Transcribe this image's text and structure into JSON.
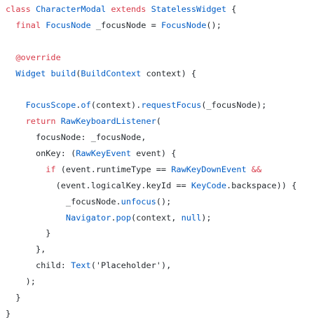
{
  "editor": {
    "lines": [
      [
        [
          "class ",
          "kw"
        ],
        [
          "CharacterModal ",
          "ty"
        ],
        [
          "extends ",
          "kw"
        ],
        [
          "StatelessWidget ",
          "ty"
        ],
        [
          "{",
          "pl"
        ]
      ],
      [
        [
          "  final ",
          "kw"
        ],
        [
          "FocusNode ",
          "ty"
        ],
        [
          "_focusNode = ",
          "pl"
        ],
        [
          "FocusNode",
          "ty"
        ],
        [
          "();",
          "pl"
        ]
      ],
      [],
      [
        [
          "  @override",
          "ann"
        ]
      ],
      [
        [
          "  Widget ",
          "ty"
        ],
        [
          "build",
          "ty"
        ],
        [
          "(",
          "pl"
        ],
        [
          "BuildContext ",
          "ty"
        ],
        [
          "context) {",
          "pl"
        ]
      ],
      [],
      [
        [
          "    FocusScope",
          "ty"
        ],
        [
          ".",
          "pl"
        ],
        [
          "of",
          "ty"
        ],
        [
          "(context).",
          "pl"
        ],
        [
          "requestFocus",
          "ty"
        ],
        [
          "(_focusNode);",
          "pl"
        ]
      ],
      [
        [
          "    return ",
          "kw"
        ],
        [
          "RawKeyboardListener",
          "ty"
        ],
        [
          "(",
          "pl"
        ]
      ],
      [
        [
          "      focusNode: _focusNode,",
          "pl"
        ]
      ],
      [
        [
          "      onKey: (",
          "pl"
        ],
        [
          "RawKeyEvent ",
          "ty"
        ],
        [
          "event) {",
          "pl"
        ]
      ],
      [
        [
          "        if ",
          "kw"
        ],
        [
          "(event.runtimeType == ",
          "pl"
        ],
        [
          "RawKeyDownEvent ",
          "ty"
        ],
        [
          "&&",
          "kw"
        ]
      ],
      [
        [
          "          (event.logicalKey.keyId == ",
          "pl"
        ],
        [
          "KeyCode",
          "ty"
        ],
        [
          ".backspace)) {",
          "pl"
        ]
      ],
      [
        [
          "            _focusNode.",
          "pl"
        ],
        [
          "unfocus",
          "ty"
        ],
        [
          "();",
          "pl"
        ]
      ],
      [
        [
          "            Navigator",
          "ty"
        ],
        [
          ".",
          "pl"
        ],
        [
          "pop",
          "ty"
        ],
        [
          "(context, ",
          "pl"
        ],
        [
          "null",
          "ty"
        ],
        [
          ");",
          "pl"
        ]
      ],
      [
        [
          "        }",
          "pl"
        ]
      ],
      [
        [
          "      },",
          "pl"
        ]
      ],
      [
        [
          "      child: ",
          "pl"
        ],
        [
          "Text",
          "ty"
        ],
        [
          "(",
          "pl"
        ],
        [
          "'Placeholder'",
          "pl"
        ],
        [
          "),",
          "pl"
        ]
      ],
      [
        [
          "    );",
          "pl"
        ]
      ],
      [
        [
          "  }",
          "pl"
        ]
      ],
      [
        [
          "}",
          "pl"
        ]
      ]
    ]
  }
}
